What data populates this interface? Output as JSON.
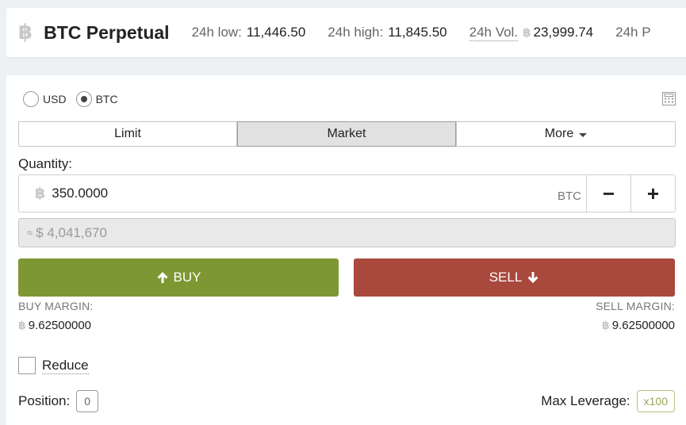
{
  "header": {
    "logo_glyph": "฿",
    "title": "BTC Perpetual",
    "stats": {
      "low_label": "24h low:",
      "low_value": "11,446.50",
      "high_label": "24h high:",
      "high_value": "11,845.50",
      "vol_label": "24h Vol.",
      "vol_value": "23,999.74",
      "next_label": "24h P"
    }
  },
  "currency": {
    "options": [
      "USD",
      "BTC"
    ],
    "selected": "BTC"
  },
  "order_tabs": {
    "limit": "Limit",
    "market": "Market",
    "more": "More",
    "active": "Market"
  },
  "quantity": {
    "label": "Quantity:",
    "value": "350.0000",
    "unit": "BTC",
    "decrement": "−",
    "increment": "+"
  },
  "fiat_equivalent": {
    "prefix": "≈",
    "value": "$ 4,041,670"
  },
  "actions": {
    "buy_label": "BUY",
    "sell_label": "SELL",
    "buy_color": "#7d9732",
    "sell_color": "#a9483d"
  },
  "margins": {
    "buy_label": "BUY MARGIN:",
    "buy_value": "9.62500000",
    "sell_label": "SELL MARGIN:",
    "sell_value": "9.62500000"
  },
  "reduce": {
    "label": "Reduce",
    "checked": false
  },
  "position": {
    "label": "Position:",
    "value": "0"
  },
  "leverage": {
    "label": "Max Leverage:",
    "value": "x100"
  },
  "icons": {
    "btc": "bitcoin-icon",
    "calculator": "calculator-icon",
    "buy_arrow": "arrow-up-icon",
    "sell_arrow": "arrow-down-icon",
    "caret": "caret-down-icon"
  }
}
